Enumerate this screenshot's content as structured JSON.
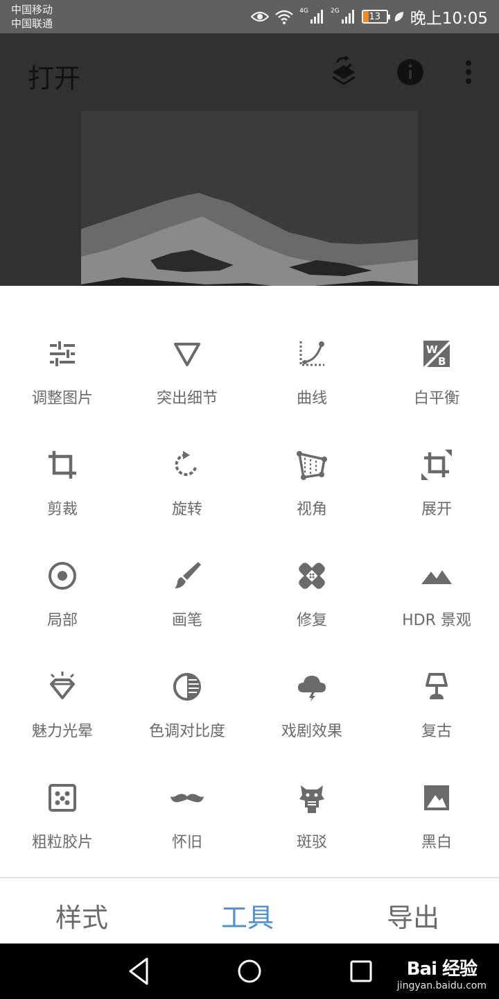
{
  "status_bar": {
    "carrier1": "中国移动",
    "carrier2": "中国联通",
    "net1": "4G",
    "net2": "2G",
    "battery": "13",
    "time": "晚上10:05"
  },
  "header": {
    "title": "打开",
    "icons": [
      "layers-swap-icon",
      "info-icon",
      "more-vert-icon"
    ]
  },
  "tools": [
    {
      "label": "调整图片",
      "icon": "tune-sliders-icon"
    },
    {
      "label": "突出细节",
      "icon": "details-triangle-icon"
    },
    {
      "label": "曲线",
      "icon": "curves-icon"
    },
    {
      "label": "白平衡",
      "icon": "white-balance-icon"
    },
    {
      "label": "剪裁",
      "icon": "crop-icon"
    },
    {
      "label": "旋转",
      "icon": "rotate-icon"
    },
    {
      "label": "视角",
      "icon": "perspective-icon"
    },
    {
      "label": "展开",
      "icon": "expand-icon"
    },
    {
      "label": "局部",
      "icon": "selective-icon"
    },
    {
      "label": "画笔",
      "icon": "brush-icon"
    },
    {
      "label": "修复",
      "icon": "healing-icon"
    },
    {
      "label": "HDR 景观",
      "icon": "hdr-mountain-icon"
    },
    {
      "label": "魅力光晕",
      "icon": "glamour-glow-icon"
    },
    {
      "label": "色调对比度",
      "icon": "tonal-contrast-icon"
    },
    {
      "label": "戏剧效果",
      "icon": "drama-cloud-icon"
    },
    {
      "label": "复古",
      "icon": "vintage-lamp-icon"
    },
    {
      "label": "粗粒胶片",
      "icon": "grainy-film-icon"
    },
    {
      "label": "怀旧",
      "icon": "retrolux-mustache-icon"
    },
    {
      "label": "斑驳",
      "icon": "grunge-icon"
    },
    {
      "label": "黑白",
      "icon": "black-white-icon"
    }
  ],
  "tabs": {
    "styles": "样式",
    "tools": "工具",
    "export": "导出"
  },
  "watermark": {
    "logo": "Bai 经验",
    "url": "jingyan.baidu.com"
  },
  "colors": {
    "accent": "#4a8fdc",
    "icon": "#6a6a6a",
    "status_bar": "#606060",
    "battery_fill": "#f08a1c"
  }
}
